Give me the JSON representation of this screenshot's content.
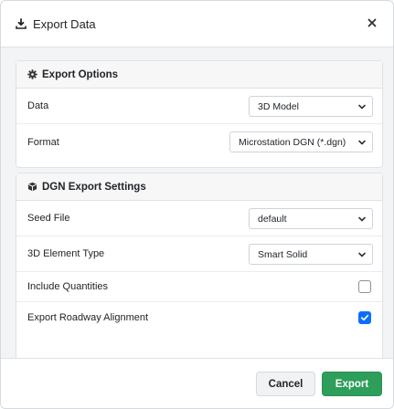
{
  "dialog": {
    "title": "Export Data",
    "title_icon": "download-icon",
    "close_icon": "close-icon"
  },
  "export_options": {
    "heading": "Export Options",
    "heading_icon": "gear-icon",
    "data_label": "Data",
    "data_value": "3D Model",
    "format_label": "Format",
    "format_value": "Microstation DGN (*.dgn)"
  },
  "dgn_settings": {
    "heading": "DGN Export Settings",
    "heading_icon": "cube-icon",
    "seed_file_label": "Seed File",
    "seed_file_value": "default",
    "element_type_label": "3D Element Type",
    "element_type_value": "Smart Solid",
    "include_quantities_label": "Include Quantities",
    "include_quantities_checked": false,
    "roadway_alignment_label": "Export Roadway Alignment",
    "roadway_alignment_checked": true
  },
  "footer": {
    "cancel_label": "Cancel",
    "export_label": "Export"
  },
  "colors": {
    "primary_green": "#2e9e5b",
    "checkbox_blue": "#0d6efd",
    "body_bg": "#f3f4f6"
  }
}
